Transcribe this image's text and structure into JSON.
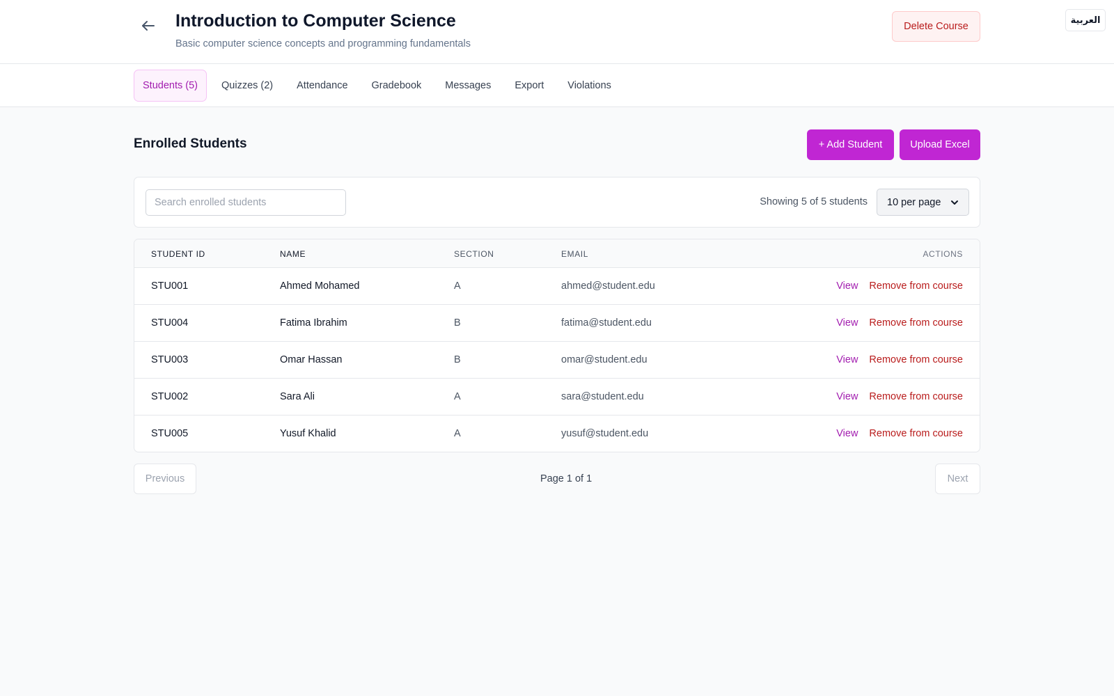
{
  "header": {
    "title": "Introduction to Computer Science",
    "subtitle": "Basic computer science concepts and programming fundamentals",
    "delete_label": "Delete Course",
    "language_label": "العربية",
    "back_icon": "arrow-left-icon"
  },
  "tabs": [
    {
      "label": "Students (5)",
      "active": true
    },
    {
      "label": "Quizzes (2)",
      "active": false
    },
    {
      "label": "Attendance",
      "active": false
    },
    {
      "label": "Gradebook",
      "active": false
    },
    {
      "label": "Messages",
      "active": false
    },
    {
      "label": "Export",
      "active": false
    },
    {
      "label": "Violations",
      "active": false
    }
  ],
  "section": {
    "title": "Enrolled Students",
    "add_label": "+ Add Student",
    "upload_label": "Upload Excel"
  },
  "toolbar": {
    "search_placeholder": "Search enrolled students",
    "search_value": "",
    "showing_text": "Showing 5 of 5 students",
    "per_page_value": "10 per page"
  },
  "table": {
    "headers": {
      "student_id": "STUDENT ID",
      "name": "NAME",
      "section": "SECTION",
      "email": "EMAIL",
      "actions": "ACTIONS"
    },
    "view_label": "View",
    "remove_label": "Remove from course",
    "rows": [
      {
        "id": "STU001",
        "name": "Ahmed Mohamed",
        "section": "A",
        "email": "ahmed@student.edu"
      },
      {
        "id": "STU004",
        "name": "Fatima Ibrahim",
        "section": "B",
        "email": "fatima@student.edu"
      },
      {
        "id": "STU003",
        "name": "Omar Hassan",
        "section": "B",
        "email": "omar@student.edu"
      },
      {
        "id": "STU002",
        "name": "Sara Ali",
        "section": "A",
        "email": "sara@student.edu"
      },
      {
        "id": "STU005",
        "name": "Yusuf Khalid",
        "section": "A",
        "email": "yusuf@student.edu"
      }
    ]
  },
  "pagination": {
    "previous_label": "Previous",
    "next_label": "Next",
    "page_info": "Page 1 of 1"
  },
  "colors": {
    "accent": "#c026d3",
    "accent_text": "#a21caf",
    "danger": "#b91c1c",
    "background": "#f9fafb"
  }
}
